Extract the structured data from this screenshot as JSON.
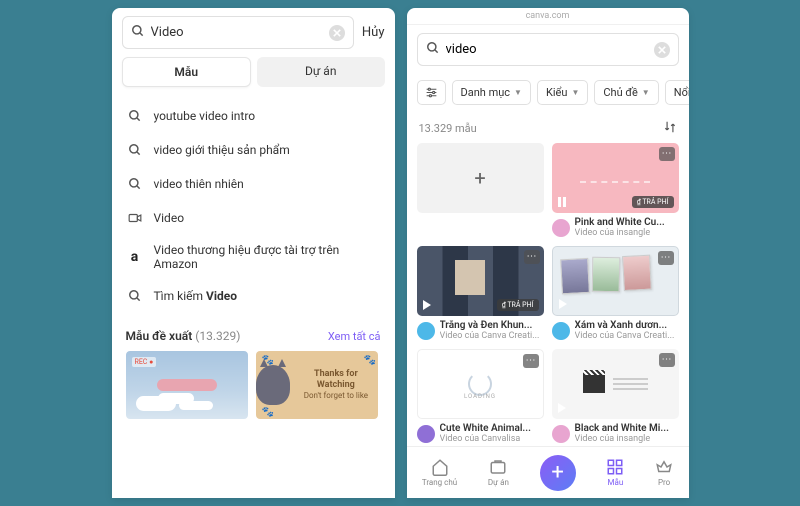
{
  "left": {
    "search_value": "Video",
    "cancel": "Hủy",
    "tabs": {
      "templates": "Mẫu",
      "projects": "Dự án"
    },
    "suggestions": [
      {
        "kind": "search",
        "text": "youtube video intro"
      },
      {
        "kind": "search",
        "text": "video giới thiệu sản phẩm"
      },
      {
        "kind": "search",
        "text": "video thiên nhiên"
      },
      {
        "kind": "video",
        "text": "Video"
      },
      {
        "kind": "amazon",
        "text": "Video thương hiệu được tài trợ trên Amazon"
      },
      {
        "kind": "search",
        "text": "Tìm kiếm Video",
        "bold": "Video"
      }
    ],
    "section": {
      "title": "Mẫu đề xuất",
      "count": "(13.329)",
      "see_all": "Xem tất cả"
    },
    "thumb2_title": "Thanks for Watching",
    "thumb2_sub": "Don't forget to like"
  },
  "right": {
    "url": "canva.com",
    "search_value": "video",
    "filters": {
      "cat": "Danh mục",
      "style": "Kiểu",
      "topic": "Chủ đề",
      "more": "Nổi"
    },
    "results_count": "13.329 mẫu",
    "badge_paid": "TRẢ PHÍ",
    "cards": [
      {
        "title": "Pink and White Cu...",
        "author": "Video của insangle",
        "avatar": "#e8a5d0",
        "thumb": "pink",
        "paid": true,
        "pause": true
      },
      {
        "title": "Trắng và Đen Khun...",
        "author": "Video của Canva Creati...",
        "avatar": "#4db8e8",
        "thumb": "bw",
        "paid": true,
        "play": true
      },
      {
        "title": "Xám và Xanh dươn...",
        "author": "Video của Canva Creati...",
        "avatar": "#4db8e8",
        "thumb": "blue",
        "play": true
      },
      {
        "title": "Cute White Animal...",
        "author": "Video của Canvalisa",
        "avatar": "#8f6fd6",
        "thumb": "white",
        "play": true
      },
      {
        "title": "Black and White Mi...",
        "author": "Video của insangle",
        "avatar": "#e8a5d0",
        "thumb": "film",
        "play": true
      }
    ],
    "nav": {
      "home": "Trang chủ",
      "projects": "Dự án",
      "templates": "Mẫu",
      "pro": "Pro"
    }
  }
}
